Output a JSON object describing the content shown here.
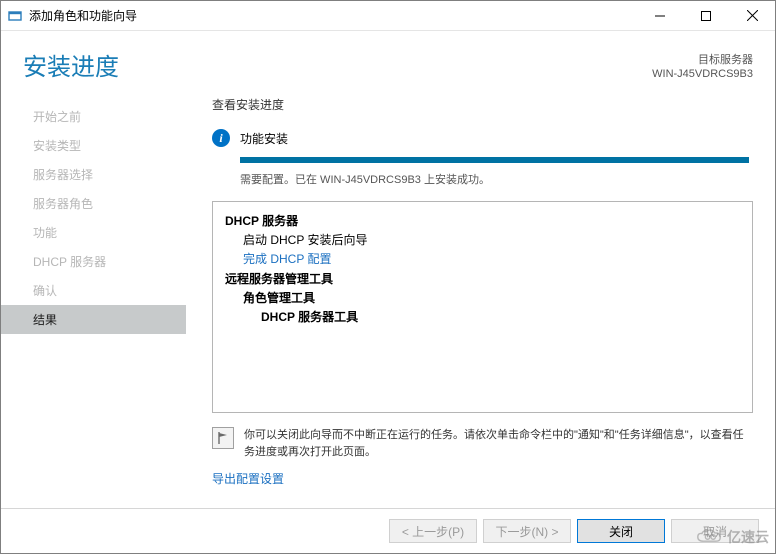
{
  "window": {
    "title": "添加角色和功能向导"
  },
  "header": {
    "title": "安装进度",
    "target_label": "目标服务器",
    "target_value": "WIN-J45VDRCS9B3"
  },
  "nav": {
    "items": [
      {
        "label": "开始之前"
      },
      {
        "label": "安装类型"
      },
      {
        "label": "服务器选择"
      },
      {
        "label": "服务器角色"
      },
      {
        "label": "功能"
      },
      {
        "label": "DHCP 服务器"
      },
      {
        "label": "确认"
      },
      {
        "label": "结果"
      }
    ],
    "active_index": 7
  },
  "main": {
    "section_label": "查看安装进度",
    "status_text": "功能安装",
    "progress_percent": 100,
    "progress_msg": "需要配置。已在 WIN-J45VDRCS9B3 上安装成功。",
    "results": {
      "group1_title": "DHCP 服务器",
      "group1_sub": "启动 DHCP 安装后向导",
      "group1_link": "完成 DHCP 配置",
      "group2_title": "远程服务器管理工具",
      "group2_sub1": "角色管理工具",
      "group2_sub2": "DHCP 服务器工具"
    },
    "note_text": "你可以关闭此向导而不中断正在运行的任务。请依次单击命令栏中的\"通知\"和\"任务详细信息\"，以查看任务进度或再次打开此页面。",
    "export_link": "导出配置设置"
  },
  "footer": {
    "prev": "< 上一步(P)",
    "next": "下一步(N) >",
    "close": "关闭",
    "cancel": "取消"
  },
  "watermark": "亿速云"
}
